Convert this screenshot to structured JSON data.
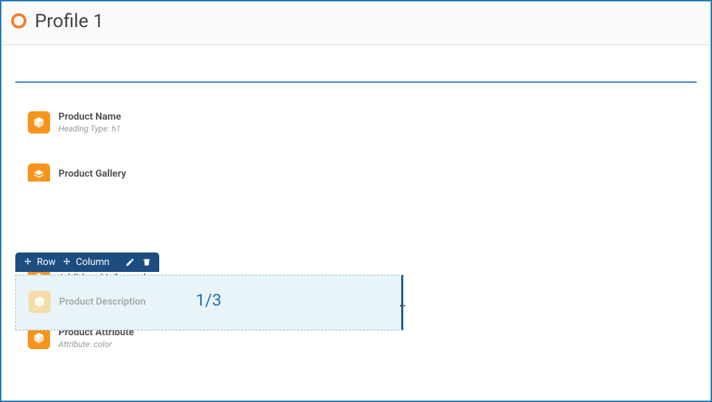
{
  "header": {
    "title": "Profile 1"
  },
  "toolbar": {
    "row_label": "Row",
    "column_label": "Column"
  },
  "selected": {
    "fraction": "1/3",
    "block_title": "Product Description"
  },
  "blocks": {
    "product_name": {
      "title": "Product Name",
      "sub": "Heading Type: h1"
    },
    "product_gallery": {
      "title": "Product Gallery"
    },
    "additional_info": {
      "title": "Additional Information"
    },
    "product_attribute": {
      "title": "Product Attribute",
      "sub": "Attribute: color"
    }
  }
}
